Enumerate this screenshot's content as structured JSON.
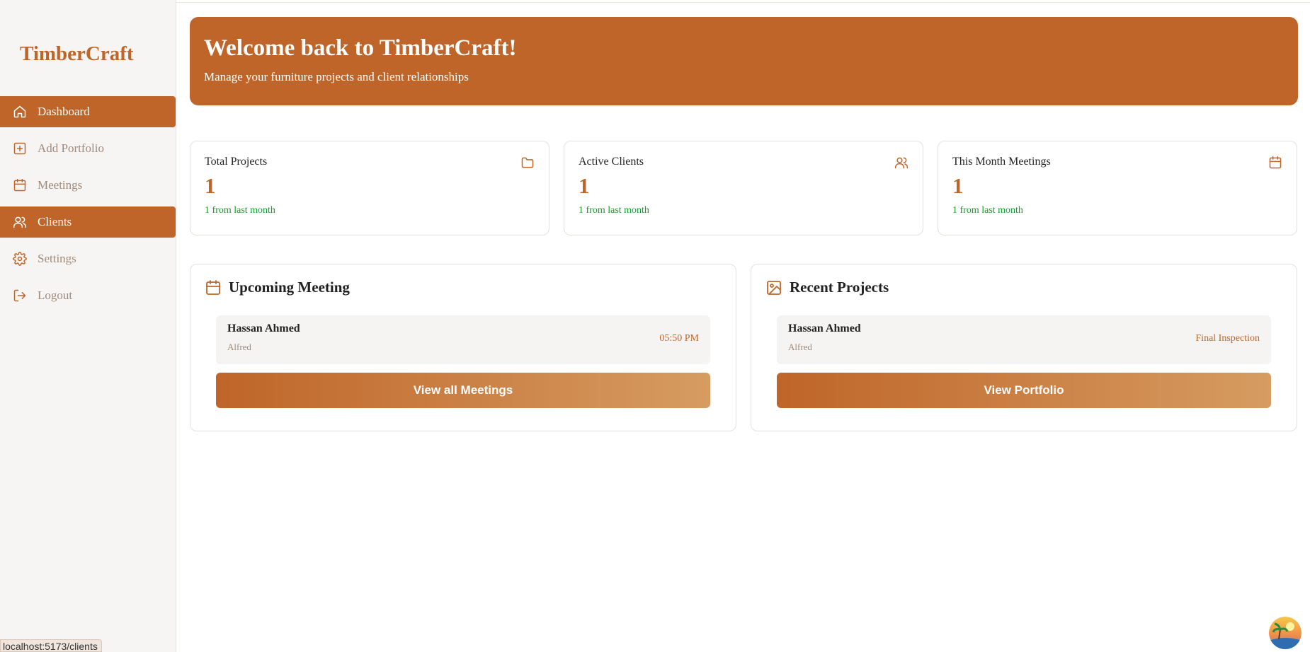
{
  "sidebar": {
    "brand": "TimberCraft",
    "items": [
      {
        "label": "Dashboard",
        "icon": "home-icon"
      },
      {
        "label": "Add Portfolio",
        "icon": "plus-square-icon"
      },
      {
        "label": "Meetings",
        "icon": "calendar-icon"
      },
      {
        "label": "Clients",
        "icon": "users-icon"
      },
      {
        "label": "Settings",
        "icon": "gear-icon"
      },
      {
        "label": "Logout",
        "icon": "logout-icon"
      }
    ]
  },
  "banner": {
    "title": "Welcome back to TimberCraft!",
    "subtitle": "Manage your furniture projects and client relationships"
  },
  "stats": [
    {
      "label": "Total Projects",
      "value": "1",
      "delta": "1 from last month",
      "icon": "folder-icon"
    },
    {
      "label": "Active Clients",
      "value": "1",
      "delta": "1 from last month",
      "icon": "users-icon"
    },
    {
      "label": "This Month Meetings",
      "value": "1",
      "delta": "1 from last month",
      "icon": "calendar-icon"
    }
  ],
  "upcoming": {
    "title": "Upcoming Meeting",
    "item": {
      "name": "Hassan Ahmed",
      "sub": "Alfred",
      "time": "05:50 PM"
    },
    "button": "View all Meetings"
  },
  "recent": {
    "title": "Recent Projects",
    "item": {
      "name": "Hassan Ahmed",
      "sub": "Alfred",
      "status": "Final Inspection"
    },
    "button": "View Portfolio"
  },
  "status_bar": {
    "url": "localhost:5173/clients"
  },
  "colors": {
    "accent": "#bf6529",
    "positive": "#1a9a2a",
    "muted": "#a08a7b"
  }
}
